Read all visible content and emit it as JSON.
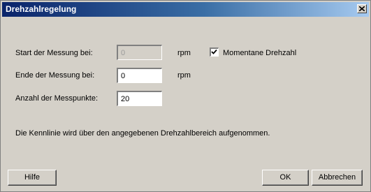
{
  "window": {
    "title": "Drehzahlregelung",
    "close_icon": "close-icon"
  },
  "form": {
    "start_label": "Start der Messung bei:",
    "start_value": "0",
    "start_unit": "rpm",
    "momentane_checked": true,
    "momentane_label": "Momentane Drehzahl",
    "end_label": "Ende der Messung bei:",
    "end_value": "0",
    "end_unit": "rpm",
    "points_label": "Anzahl der Messpunkte:",
    "points_value": "20"
  },
  "info_text": "Die Kennlinie wird über den angegebenen Drehzahlbereich aufgenommen.",
  "buttons": {
    "help": "Hilfe",
    "ok": "OK",
    "cancel": "Abbrechen"
  }
}
